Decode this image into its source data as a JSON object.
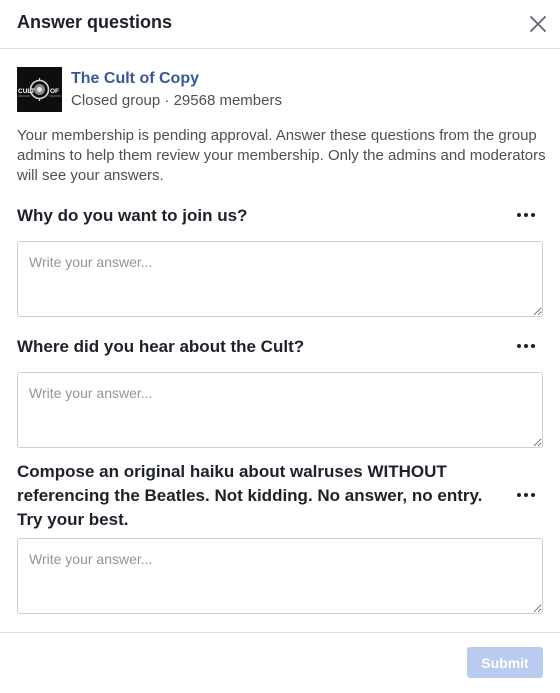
{
  "dialog": {
    "title": "Answer questions"
  },
  "group": {
    "logo_text_left": "CULT",
    "logo_text_right": "OF",
    "name": "The Cult of Copy",
    "privacy": "Closed group",
    "separator": "·",
    "members": "29568 members"
  },
  "intro": "Your membership is pending approval. Answer these questions from the group admins to help them review your membership. Only the admins and moderators will see your answers.",
  "questions": [
    {
      "text": "Why do you want to join us?",
      "placeholder": "Write your answer...",
      "value": ""
    },
    {
      "text": "Where did you hear about the Cult?",
      "placeholder": "Write your answer...",
      "value": ""
    },
    {
      "text": "Compose an original haiku about walruses WITHOUT referencing the Beatles. Not kidding. No answer, no entry. Try your best.",
      "placeholder": "Write your answer...",
      "value": ""
    }
  ],
  "footer": {
    "submit_label": "Submit",
    "submit_enabled": false
  },
  "colors": {
    "link": "#385898",
    "submit_disabled": "#b9cbef"
  },
  "icons": {
    "close": "close-icon",
    "more": "more-options-icon",
    "logo": "group-logo"
  }
}
